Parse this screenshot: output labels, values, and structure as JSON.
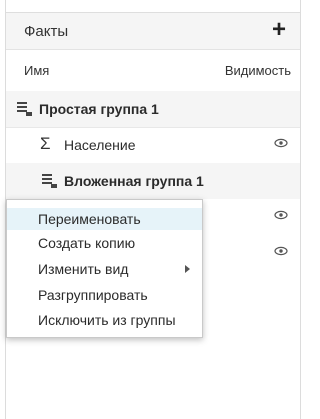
{
  "panel": {
    "title": "Факты",
    "add_label": "+",
    "columns": {
      "name": "Имя",
      "visibility": "Видимость"
    }
  },
  "tree": {
    "group": {
      "label": "Простая группа 1",
      "icon": "group-icon"
    },
    "item1": {
      "label": "Население",
      "icon": "sigma-icon"
    },
    "group2": {
      "label": "Вложенная группа 1",
      "icon": "group-icon"
    }
  },
  "context_menu": {
    "items": [
      {
        "label": "Переименовать",
        "active": true
      },
      {
        "label": "Создать копию"
      },
      {
        "label": "Изменить вид",
        "submenu": true
      },
      {
        "label": "Разгруппировать"
      },
      {
        "label": "Исключить из группы"
      }
    ]
  },
  "colors": {
    "highlight": "#e6f3f9",
    "header_bg": "#f5f5f5"
  }
}
